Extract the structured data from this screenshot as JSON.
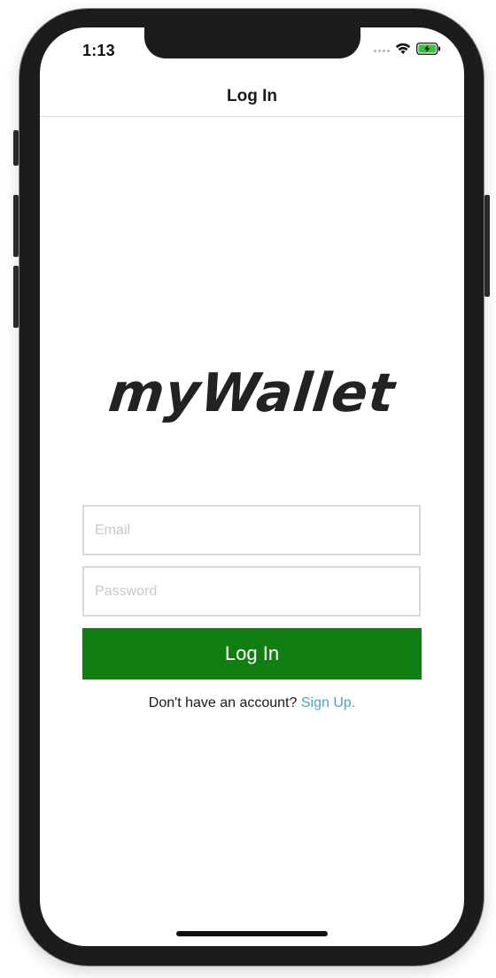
{
  "status_bar": {
    "time": "1:13"
  },
  "nav": {
    "title": "Log In"
  },
  "logo": {
    "text": "myWallet"
  },
  "form": {
    "email_placeholder": "Email",
    "password_placeholder": "Password",
    "login_label": "Log In"
  },
  "signup": {
    "prompt": "Don't have an account?",
    "link": "Sign Up."
  },
  "colors": {
    "accent_green": "#107e12",
    "link_teal": "#46a6b8",
    "battery_green": "#3cc13c"
  },
  "icons": [
    "signal-icon",
    "wifi-icon",
    "battery-charging-icon"
  ]
}
